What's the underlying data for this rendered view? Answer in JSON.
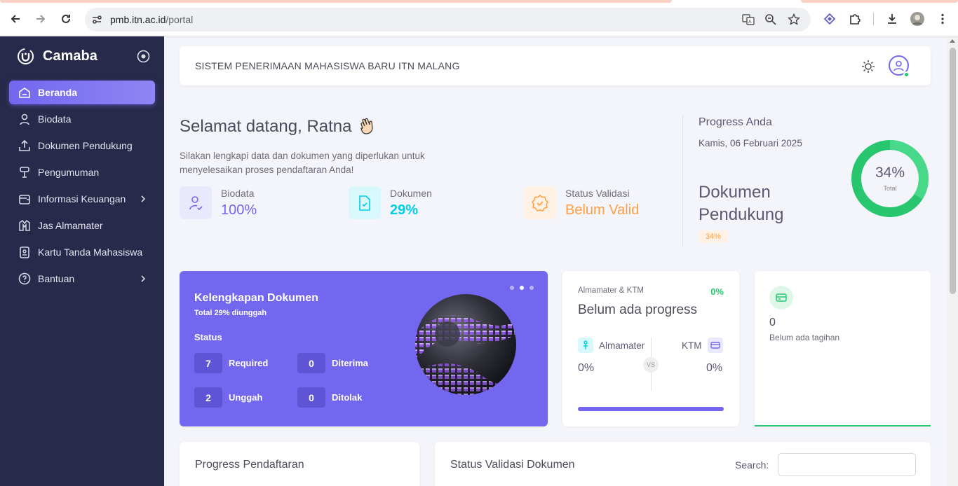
{
  "browser": {
    "url_host": "pmb.itn.ac.id",
    "url_path": "/portal"
  },
  "sidebar": {
    "brand": "Camaba",
    "items": [
      {
        "label": "Beranda",
        "icon": "home-icon",
        "active": true
      },
      {
        "label": "Biodata",
        "icon": "user-icon"
      },
      {
        "label": "Dokumen Pendukung",
        "icon": "upload-icon"
      },
      {
        "label": "Pengumuman",
        "icon": "announcement-icon"
      },
      {
        "label": "Informasi Keuangan",
        "icon": "finance-icon",
        "has_sub": true
      },
      {
        "label": "Jas Almamater",
        "icon": "jacket-icon"
      },
      {
        "label": "Kartu Tanda Mahasiswa",
        "icon": "id-card-icon"
      },
      {
        "label": "Bantuan",
        "icon": "help-icon",
        "has_sub": true
      }
    ]
  },
  "header": {
    "title": "SISTEM PENERIMAAN MAHASISWA BARU ITN MALANG"
  },
  "welcome": {
    "greeting": "Selamat datang, Ratna",
    "description": "Silakan lengkapi data dan dokumen yang diperlukan untuk menyelesaikan proses pendaftaran Anda!",
    "stats": [
      {
        "label": "Biodata",
        "value": "100%",
        "color": "#7367f0"
      },
      {
        "label": "Dokumen",
        "value": "29%",
        "color": "#00cfe8"
      },
      {
        "label": "Status Validasi",
        "value": "Belum Valid",
        "color": "#ff9f43"
      }
    ]
  },
  "progress": {
    "title": "Progress Anda",
    "date": "Kamis, 06 Februari 2025",
    "heading": "Dokumen Pendukung",
    "badge": "34%",
    "donut_percent": "34%",
    "donut_label": "Total",
    "donut_value": 0.34
  },
  "kelengkapan": {
    "title": "Kelengkapan Dokumen",
    "subtitle": "Total 29% diunggah",
    "status_label": "Status",
    "required_count": "7",
    "required_label": "Required",
    "diterima_count": "0",
    "diterima_label": "Diterima",
    "unggah_count": "2",
    "unggah_label": "Unggah",
    "ditolak_count": "0",
    "ditolak_label": "Ditolak"
  },
  "almamater": {
    "heading": "Almamater & KTM",
    "percent": "0%",
    "status": "Belum ada progress",
    "left_label": "Almamater",
    "right_label": "KTM",
    "vs": "VS",
    "left_value": "0%",
    "right_value": "0%",
    "progress_value": 1.0
  },
  "tagihan": {
    "count": "0",
    "text": "Belum ada tagihan"
  },
  "bottom": {
    "progress_title": "Progress Pendaftaran",
    "status_title": "Status Validasi Dokumen",
    "search_label": "Search:",
    "search_value": ""
  }
}
